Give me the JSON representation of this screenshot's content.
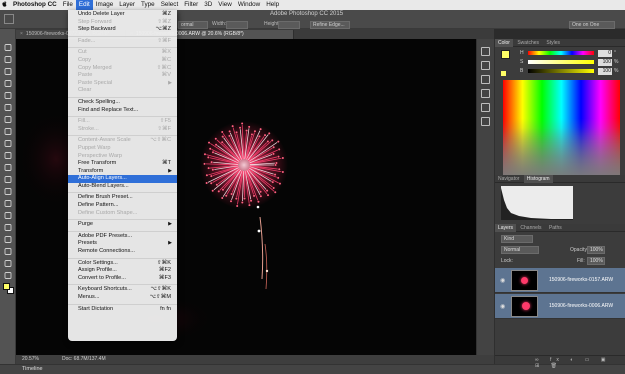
{
  "menubar": {
    "app": "Photoshop CC",
    "items": [
      "File",
      "Edit",
      "Image",
      "Layer",
      "Type",
      "Select",
      "Filter",
      "3D",
      "View",
      "Window",
      "Help"
    ],
    "active": "Edit"
  },
  "options": {
    "title": "Adobe Photoshop CC 2015",
    "mode": "ormal",
    "width_label": "Width:",
    "height_label": "Height:",
    "refine_edge": "Refine Edge...",
    "workspace": "One on One"
  },
  "tabs": [
    {
      "label": "150906-fireworks-0072.ARW, RGB/8*",
      "active": false
    },
    {
      "label": "150906-fireworks-0006.ARW @ 20.6% (RGB/8*)",
      "active": true
    }
  ],
  "edit_menu": [
    {
      "label": "Undo Delete Layer",
      "shortcut": "⌘Z",
      "disabled": false
    },
    {
      "label": "Step Forward",
      "shortcut": "⇧⌘Z",
      "disabled": true
    },
    {
      "label": "Step Backward",
      "shortcut": "⌥⌘Z",
      "disabled": false
    },
    {
      "sep": true
    },
    {
      "label": "Fade...",
      "shortcut": "⇧⌘F",
      "disabled": true
    },
    {
      "sep": true
    },
    {
      "label": "Cut",
      "shortcut": "⌘X",
      "disabled": true
    },
    {
      "label": "Copy",
      "shortcut": "⌘C",
      "disabled": true
    },
    {
      "label": "Copy Merged",
      "shortcut": "⇧⌘C",
      "disabled": true
    },
    {
      "label": "Paste",
      "shortcut": "⌘V",
      "disabled": true
    },
    {
      "label": "Paste Special",
      "submenu": true,
      "disabled": true
    },
    {
      "label": "Clear",
      "disabled": true
    },
    {
      "sep": true
    },
    {
      "label": "Check Spelling...",
      "disabled": false
    },
    {
      "label": "Find and Replace Text...",
      "disabled": false
    },
    {
      "sep": true
    },
    {
      "label": "Fill...",
      "shortcut": "⇧F5",
      "disabled": true
    },
    {
      "label": "Stroke...",
      "shortcut": "⇧⌘F",
      "disabled": true
    },
    {
      "sep": true
    },
    {
      "label": "Content-Aware Scale",
      "shortcut": "⌥⇧⌘C",
      "disabled": true
    },
    {
      "label": "Puppet Warp",
      "disabled": true
    },
    {
      "label": "Perspective Warp",
      "disabled": true
    },
    {
      "label": "Free Transform",
      "shortcut": "⌘T",
      "disabled": false
    },
    {
      "label": "Transform",
      "submenu": true,
      "disabled": false
    },
    {
      "label": "Auto-Align Layers...",
      "disabled": false,
      "highlighted": true
    },
    {
      "label": "Auto-Blend Layers...",
      "disabled": false
    },
    {
      "sep": true
    },
    {
      "label": "Define Brush Preset...",
      "disabled": false
    },
    {
      "label": "Define Pattern...",
      "disabled": false
    },
    {
      "label": "Define Custom Shape...",
      "disabled": true
    },
    {
      "sep": true
    },
    {
      "label": "Purge",
      "submenu": true,
      "disabled": false
    },
    {
      "sep": true
    },
    {
      "label": "Adobe PDF Presets...",
      "disabled": false
    },
    {
      "label": "Presets",
      "submenu": true,
      "disabled": false
    },
    {
      "label": "Remote Connections...",
      "disabled": false
    },
    {
      "sep": true
    },
    {
      "label": "Color Settings...",
      "shortcut": "⇧⌘K",
      "disabled": false
    },
    {
      "label": "Assign Profile...",
      "shortcut": "⌘F2",
      "disabled": false
    },
    {
      "label": "Convert to Profile...",
      "shortcut": "⌘F3",
      "disabled": false
    },
    {
      "sep": true
    },
    {
      "label": "Keyboard Shortcuts...",
      "shortcut": "⌥⇧⌘K",
      "disabled": false
    },
    {
      "label": "Menus...",
      "shortcut": "⌥⇧⌘M",
      "disabled": false
    },
    {
      "sep": true
    },
    {
      "label": "Start Dictation",
      "shortcut": "fn fn",
      "disabled": false
    }
  ],
  "status": {
    "zoom": "20.57%",
    "doc": "Doc: 68.7M/137.4M"
  },
  "timeline": "Timeline",
  "color_panel": {
    "tabs": [
      "Color",
      "Swatches",
      "Styles"
    ],
    "active": "Color",
    "values": [
      {
        "label": "H",
        "value": "0"
      },
      {
        "label": "S",
        "value": "100"
      },
      {
        "label": "B",
        "value": "100"
      }
    ],
    "units": [
      "°",
      "%",
      "%"
    ]
  },
  "nav_panel": {
    "tabs": [
      "Navigator",
      "Histogram"
    ],
    "active": "Histogram"
  },
  "layers_panel": {
    "tabs": [
      "Layers",
      "Channels",
      "Paths"
    ],
    "active": "Layers",
    "filter": "Kind",
    "blend_mode": "Normal",
    "opacity_label": "Opacity:",
    "opacity": "100%",
    "fill_label": "Fill:",
    "fill": "100%",
    "lock_label": "Lock:",
    "layers": [
      {
        "name": "150906-fireworks-0157.ARW",
        "selected": true
      },
      {
        "name": "150906-fireworks-0006.ARW",
        "selected": true
      }
    ]
  },
  "colors": {
    "menu_highlight": "#2f6fd8",
    "firework_core": "#ff2a5a",
    "foreground": "#ffff66"
  }
}
